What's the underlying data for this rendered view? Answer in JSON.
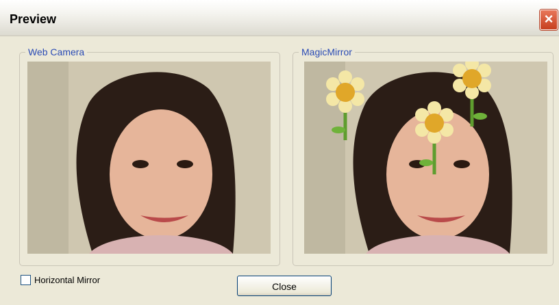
{
  "window": {
    "title": "Preview"
  },
  "webcam_group": {
    "label": "Web Camera"
  },
  "mirror_group": {
    "label": "MagicMirror"
  },
  "options": {
    "horizontal_mirror_label": "Horizontal Mirror",
    "horizontal_mirror_checked": false
  },
  "buttons": {
    "close_label": "Close"
  },
  "icons": {
    "title_close": "close-icon",
    "flower_overlay": "flower-icon"
  },
  "colors": {
    "group_label": "#2a4bb5",
    "window_bg": "#ece9d8",
    "title_close_bg": "#d9542f"
  }
}
